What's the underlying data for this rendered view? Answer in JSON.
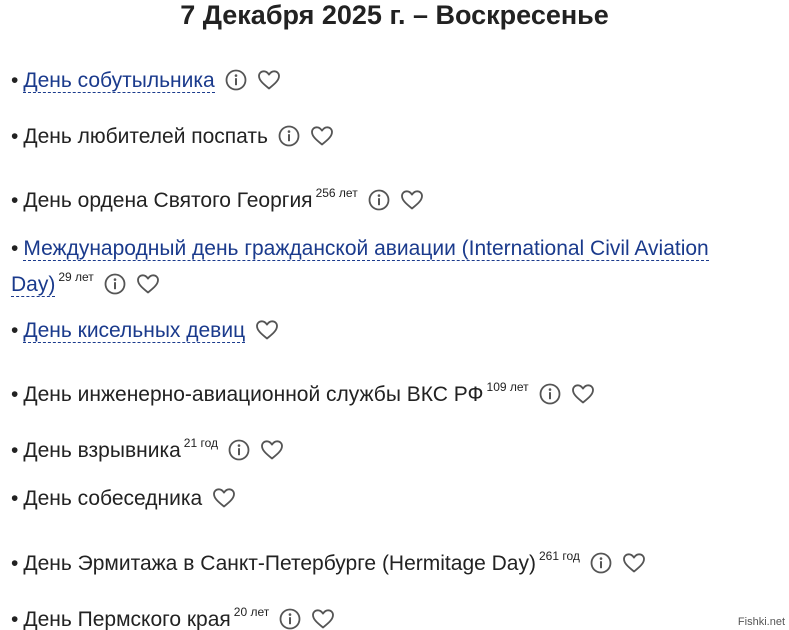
{
  "page": {
    "title": "7 Декабря 2025 г. – Воскресенье"
  },
  "bullet": "•",
  "holidays": [
    {
      "name": "День собутыльника",
      "linked": true,
      "years": "",
      "info": true
    },
    {
      "name": "День любителей поспать",
      "linked": false,
      "years": "",
      "info": true
    },
    {
      "name": "День ордена Святого Георгия",
      "linked": false,
      "years": "256 лет",
      "info": true
    },
    {
      "name": "Международный день гражданской авиации (International Civil Aviation Day)",
      "linked": true,
      "years": "29 лет",
      "info": true
    },
    {
      "name": "День кисельных девиц",
      "linked": true,
      "years": "",
      "info": false
    },
    {
      "name": "День инженерно-авиационной службы ВКС РФ",
      "linked": false,
      "years": "109 лет",
      "info": true
    },
    {
      "name": "День взрывника",
      "linked": false,
      "years": "21 год",
      "info": true
    },
    {
      "name": "День собеседника",
      "linked": false,
      "years": "",
      "info": false
    },
    {
      "name": "День Эрмитажа в Санкт-Петербурге (Hermitage Day)",
      "linked": false,
      "years": "261 год",
      "info": true
    },
    {
      "name": "День Пермского края",
      "linked": false,
      "years": "20 лет",
      "info": true
    }
  ],
  "watermark": "Fishki.net",
  "colors": {
    "link": "#1a3a8c",
    "text": "#222222",
    "icon": "#555555"
  },
  "icons": {
    "info": "info-circle-icon",
    "favorite": "heart-outline-icon"
  }
}
